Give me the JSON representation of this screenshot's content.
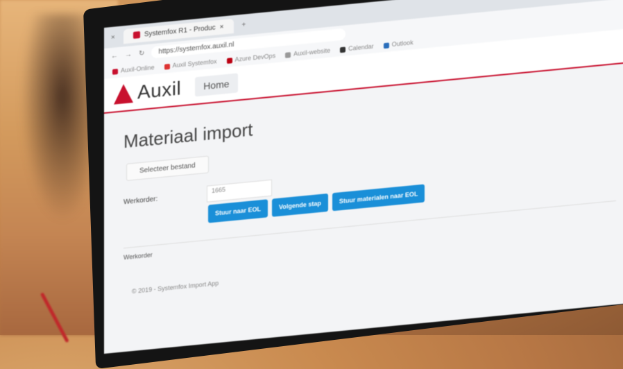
{
  "browser": {
    "tab_title": "Systemfox R1 - Produc",
    "url": "https://systemfox.auxil.nl",
    "bookmarks": [
      "Auxil-Online",
      "Auxil Systemfox",
      "Azure DevOps",
      "Auxil-website",
      "Calendar",
      "Outlook"
    ]
  },
  "app": {
    "logo_text": "Auxil",
    "nav_home": "Home"
  },
  "page": {
    "title": "Materiaal import",
    "file_button": "Selecteer bestand",
    "field_label": "Werkorder:",
    "field_value": "1665",
    "buttons": [
      "Stuur naar EOL",
      "Volgende stap",
      "Stuur materialen naar EOL"
    ],
    "section_label": "Werkorder",
    "footer": "© 2019 - Systemfox Import App"
  },
  "colors": {
    "brand": "#c8102e",
    "button": "#1a8fd8"
  }
}
